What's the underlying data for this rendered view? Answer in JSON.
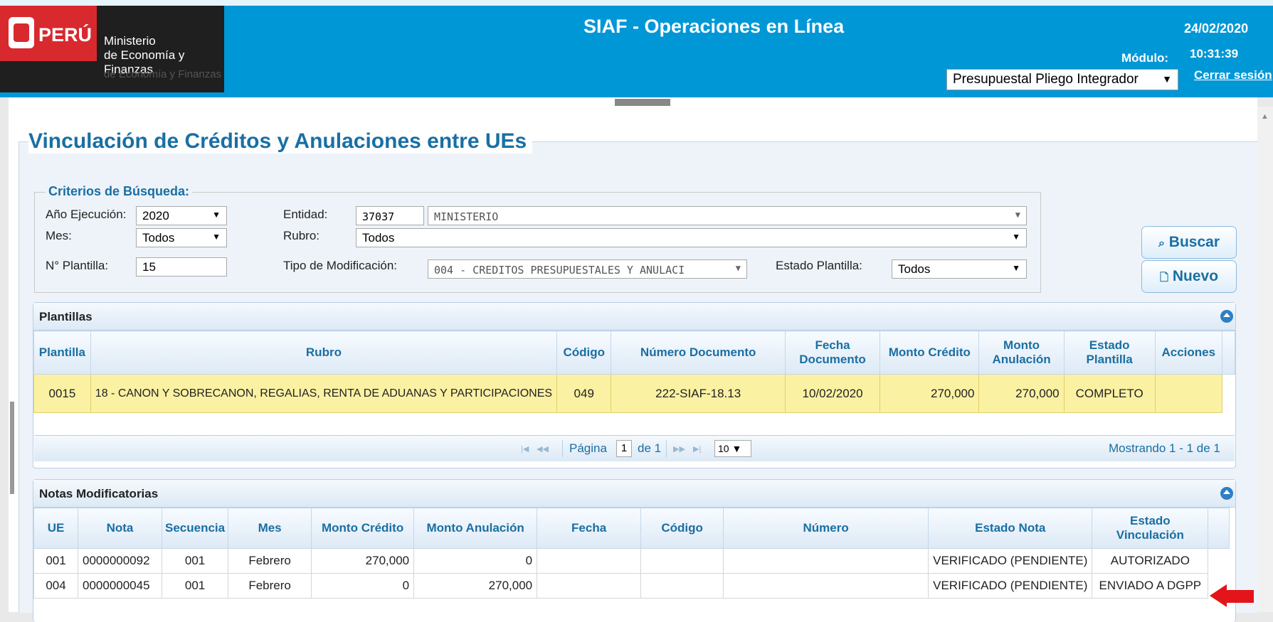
{
  "header": {
    "logo": {
      "country": "PERÚ",
      "ministry_line1": "Ministerio",
      "ministry_line2": "de Economía y Finanzas"
    },
    "title": "SIAF - Operaciones en Línea",
    "date": "24/02/2020",
    "time": "10:31:39",
    "logout_label": "Cerrar sesión",
    "module_label": "Módulo:",
    "module_value": "Presupuestal Pliego Integrador"
  },
  "page": {
    "title": "Vinculación de Créditos y Anulaciones entre UEs"
  },
  "criteria": {
    "title": "Criterios de Búsqueda:",
    "anio_label": "Año Ejecución:",
    "anio_value": "2020",
    "entidad_label": "Entidad:",
    "entidad_code": "37037",
    "entidad_name": "MINISTERIO",
    "mes_label": "Mes:",
    "mes_value": "Todos",
    "rubro_label": "Rubro:",
    "rubro_value": "Todos",
    "plantilla_label": "N° Plantilla:",
    "plantilla_value": "15",
    "tipo_label": "Tipo de Modificación:",
    "tipo_value": "004 - CREDITOS PRESUPUESTALES Y ANULACI",
    "estado_label": "Estado Plantilla:",
    "estado_value": "Todos"
  },
  "buttons": {
    "buscar": "Buscar",
    "nuevo": "Nuevo"
  },
  "plantillas": {
    "title": "Plantillas",
    "columns": [
      "Plantilla",
      "Rubro",
      "Código",
      "Número Documento",
      "Fecha Documento",
      "Monto Crédito",
      "Monto Anulación",
      "Estado Plantilla",
      "Acciones"
    ],
    "rows": [
      {
        "plantilla": "0015",
        "rubro": "18 - CANON Y SOBRECANON, REGALIAS, RENTA DE ADUANAS Y PARTICIPACIONES",
        "codigo": "049",
        "numero": "222-SIAF-18.13",
        "fecha": "10/02/2020",
        "monto_credito": "270,000",
        "monto_anulacion": "270,000",
        "estado": "COMPLETO",
        "acciones": ""
      }
    ],
    "pager": {
      "pagina_label": "Página",
      "page": "1",
      "de_label": "de 1",
      "page_size": "10",
      "summary": "Mostrando 1 - 1 de 1"
    }
  },
  "notas": {
    "title": "Notas Modificatorias",
    "columns": [
      "UE",
      "Nota",
      "Secuencia",
      "Mes",
      "Monto Crédito",
      "Monto Anulación",
      "Fecha",
      "Código",
      "Número",
      "Estado Nota",
      "Estado Vinculación"
    ],
    "rows": [
      {
        "ue": "001",
        "nota": "0000000092",
        "secuencia": "001",
        "mes": "Febrero",
        "monto_credito": "270,000",
        "monto_anulacion": "0",
        "fecha": "",
        "codigo": "",
        "numero": "",
        "estado_nota": "VERIFICADO (PENDIENTE)",
        "estado_vinculacion": "AUTORIZADO"
      },
      {
        "ue": "004",
        "nota": "0000000045",
        "secuencia": "001",
        "mes": "Febrero",
        "monto_credito": "0",
        "monto_anulacion": "270,000",
        "fecha": "",
        "codigo": "",
        "numero": "",
        "estado_nota": "VERIFICADO (PENDIENTE)",
        "estado_vinculacion": "ENVIADO A DGPP"
      }
    ]
  },
  "colors": {
    "header_blue": "#0097d6",
    "title_blue": "#1a6fa3",
    "selected_row": "#fbf1a3",
    "annotation_arrow": "#e3151a"
  }
}
